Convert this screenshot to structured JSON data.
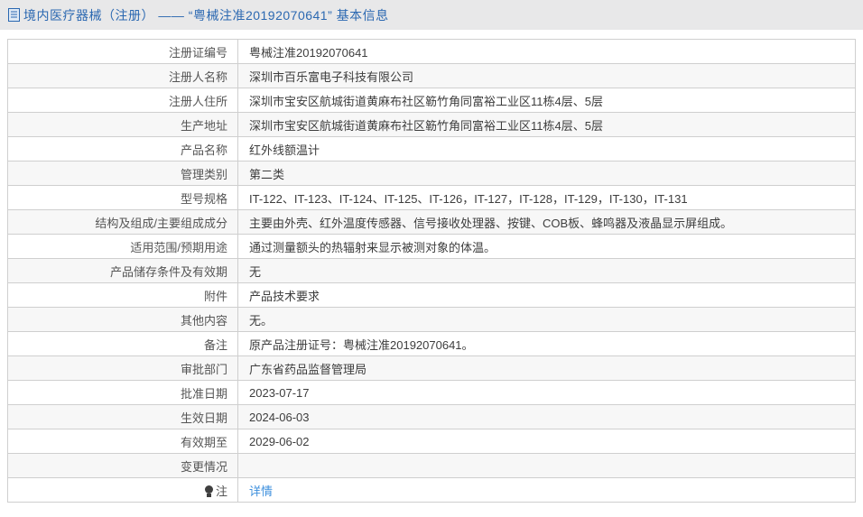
{
  "header": {
    "title": "境内医疗器械（注册） —— “粤械注准20192070641” 基本信息"
  },
  "colors": {
    "header_bg": "#e8e8e9",
    "title_blue": "#2b68b1",
    "link_blue": "#3d8fdd",
    "row_alt_bg": "#f7f7f7",
    "border": "#cfcfcf",
    "label_text": "#555555",
    "value_text": "#3d3d3d"
  },
  "icons": {
    "header_icon": "document-icon",
    "note_icon": "bulb-icon"
  },
  "table": {
    "rows": [
      {
        "label": "注册证编号",
        "value": "粤械注准20192070641"
      },
      {
        "label": "注册人名称",
        "value": "深圳市百乐富电子科技有限公司"
      },
      {
        "label": "注册人住所",
        "value": "深圳市宝安区航城街道黄麻布社区簕竹角同富裕工业区11栋4层、5层"
      },
      {
        "label": "生产地址",
        "value": "深圳市宝安区航城街道黄麻布社区簕竹角同富裕工业区11栋4层、5层"
      },
      {
        "label": "产品名称",
        "value": "红外线额温计"
      },
      {
        "label": "管理类别",
        "value": "第二类"
      },
      {
        "label": "型号规格",
        "value": "IT-122、IT-123、IT-124、IT-125、IT-126，IT-127，IT-128，IT-129，IT-130，IT-131"
      },
      {
        "label": "结构及组成/主要组成成分",
        "value": "主要由外壳、红外温度传感器、信号接收处理器、按键、COB板、蜂鸣器及液晶显示屏组成。"
      },
      {
        "label": "适用范围/预期用途",
        "value": "通过测量额头的热辐射来显示被测对象的体温。"
      },
      {
        "label": "产品储存条件及有效期",
        "value": "无"
      },
      {
        "label": "附件",
        "value": "产品技术要求"
      },
      {
        "label": "其他内容",
        "value": "无。"
      },
      {
        "label": "备注",
        "value": "原产品注册证号：粤械注准20192070641。"
      },
      {
        "label": "审批部门",
        "value": "广东省药品监督管理局"
      },
      {
        "label": "批准日期",
        "value": "2023-07-17"
      },
      {
        "label": "生效日期",
        "value": "2024-06-03"
      },
      {
        "label": "有效期至",
        "value": "2029-06-02"
      },
      {
        "label": "变更情况",
        "value": ""
      },
      {
        "label": "注",
        "value": "详情",
        "label_icon": "bulb-icon",
        "link": true
      }
    ]
  }
}
